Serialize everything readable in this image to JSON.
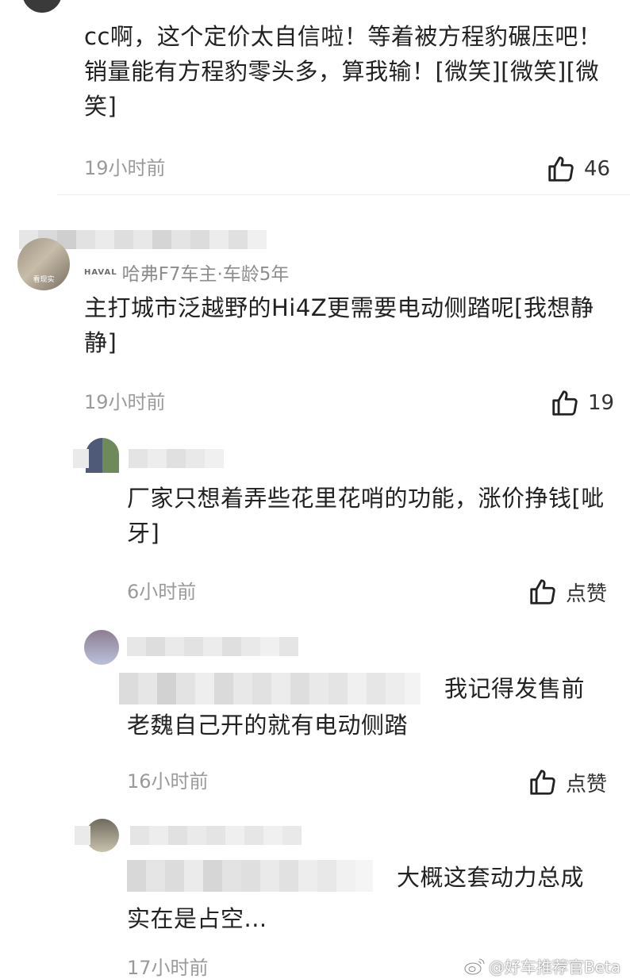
{
  "comments": [
    {
      "text": "cc啊，这个定价太自信啦！等着被方程豹碾压吧！销量能有方程豹零头多，算我输！[微笑][微笑][微笑]",
      "time": "19小时前",
      "likes": "46"
    },
    {
      "owner_brand": "HAVAL",
      "owner_tag": "哈弗F7车主·车龄5年",
      "avatar_caption": "看现实",
      "text": "主打城市泛越野的Hi4Z更需要电动侧踏呢[我想静静]",
      "time": "19小时前",
      "likes": "19"
    },
    {
      "text": "厂家只想着弄些花里花哨的功能，涨价挣钱[呲牙]",
      "time": "6小时前",
      "likes": "点赞"
    },
    {
      "text_visible": "我记得发售前老魏自己开的就有电动侧踏",
      "text_line1": "我记得发售前",
      "text_line2": "老魏自己开的就有电动侧踏",
      "time": "16小时前",
      "likes": "点赞"
    },
    {
      "text_line1": "大概这套动力总成",
      "text_line2": "实在是占空...",
      "time": "17小时前"
    }
  ],
  "watermark": "@好车推荐官Beta",
  "icons": {
    "like": "thumbs-up-icon",
    "weibo": "weibo-logo-icon"
  },
  "colors": {
    "text": "#222222",
    "meta": "#9a9a9a",
    "divider": "#ececec"
  }
}
